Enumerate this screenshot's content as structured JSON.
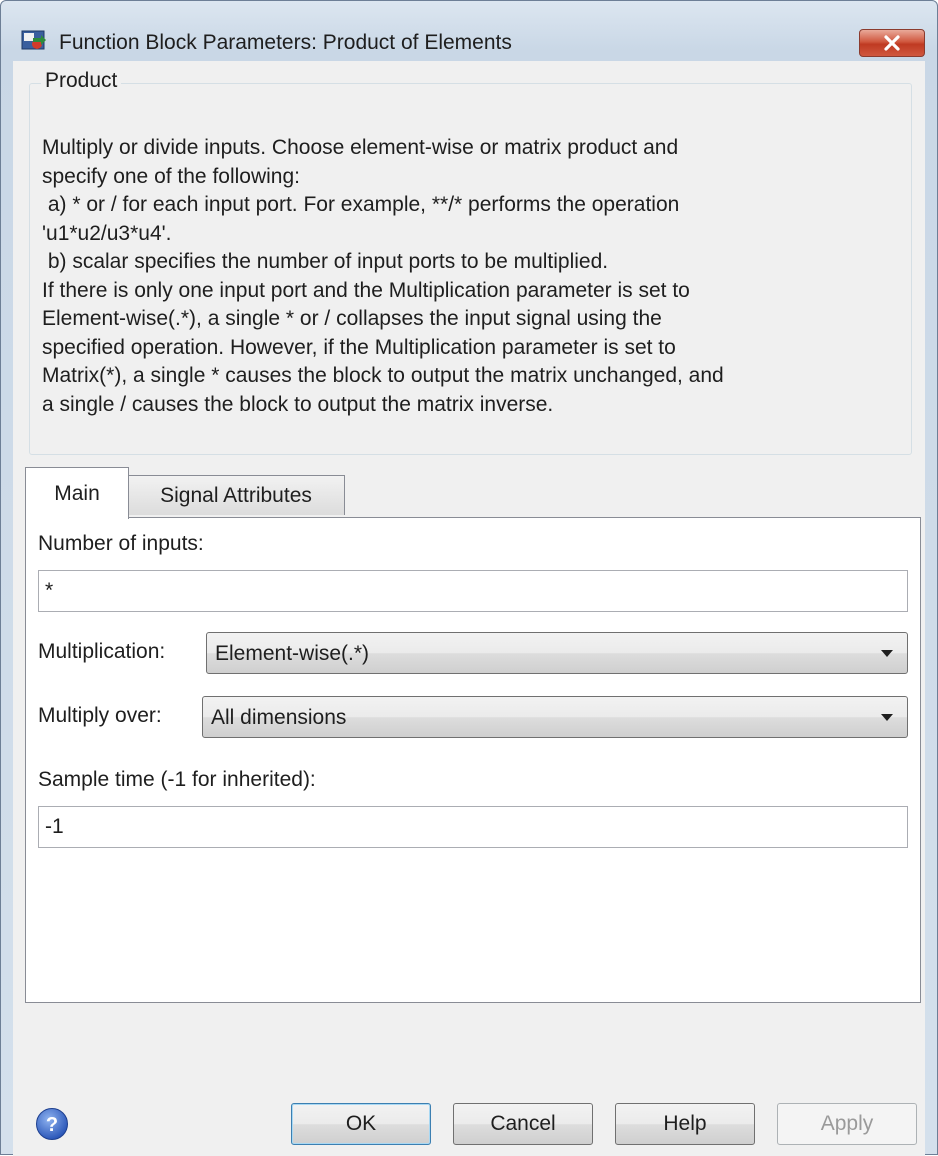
{
  "window": {
    "title": "Function Block Parameters: Product of Elements"
  },
  "groupbox": {
    "label": "Product",
    "description_lines": [
      "Multiply or divide inputs.  Choose element-wise or matrix product and",
      "specify one of the following:",
      " a) * or / for each input port. For example, **/* performs the operation",
      "'u1*u2/u3*u4'.",
      " b) scalar specifies the number of input ports to be multiplied.",
      "If there is only one input port and the Multiplication parameter is set to",
      "Element-wise(.*), a single * or / collapses the input signal using the",
      "specified operation. However, if the Multiplication parameter is set to",
      "Matrix(*), a single * causes the block to output the matrix unchanged, and",
      "a single / causes the block to output the matrix inverse."
    ]
  },
  "tabs": [
    {
      "label": "Main",
      "active": true
    },
    {
      "label": "Signal Attributes",
      "active": false
    }
  ],
  "main": {
    "num_inputs_label": "Number of inputs:",
    "num_inputs_value": "*",
    "multiplication_label": "Multiplication:",
    "multiplication_value": "Element-wise(.*)",
    "multiply_over_label": "Multiply over:",
    "multiply_over_value": "All dimensions",
    "sample_time_label": "Sample time (-1 for inherited):",
    "sample_time_value": "-1"
  },
  "buttons": {
    "ok": "OK",
    "cancel": "Cancel",
    "help": "Help",
    "apply": "Apply"
  },
  "icons": {
    "app": "simulink-block-icon",
    "close": "close-icon",
    "help": "help-question-icon"
  },
  "colors": {
    "close_button": "#c8432b",
    "titlebar": "#c9d7e6",
    "client_bg": "#f0f0f0"
  }
}
